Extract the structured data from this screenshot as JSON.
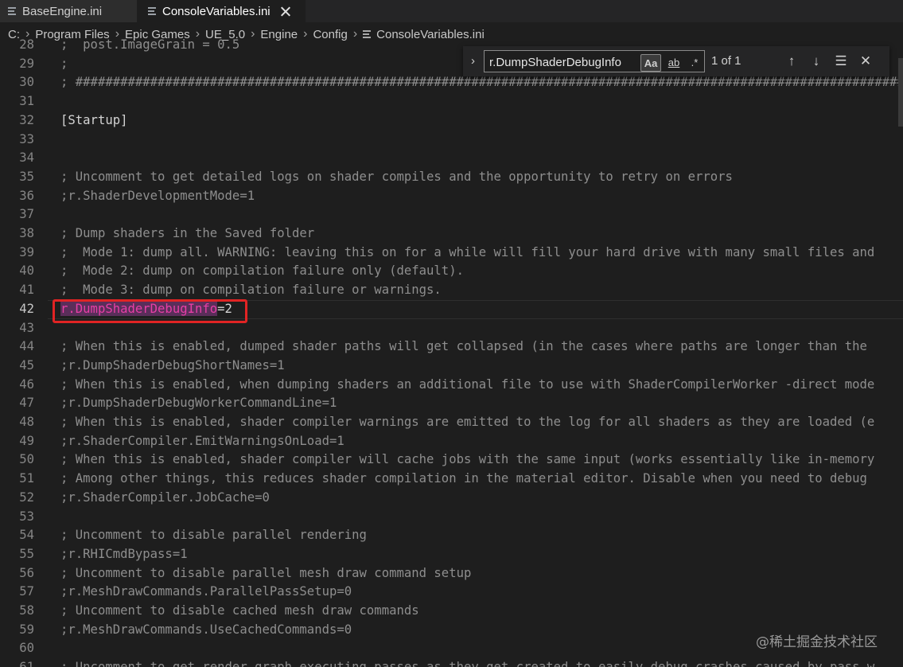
{
  "tabs": [
    {
      "label": "BaseEngine.ini",
      "icon": "file-lines-icon"
    },
    {
      "label": "ConsoleVariables.ini",
      "icon": "file-lines-icon"
    }
  ],
  "breadcrumb": [
    "C:",
    "Program Files",
    "Epic Games",
    "UE_5.0",
    "Engine",
    "Config",
    "ConsoleVariables.ini"
  ],
  "find": {
    "query": "r.DumpShaderDebugInfo",
    "match_case_label": "Aa",
    "whole_word_label": "ab",
    "regex_label": ".*",
    "count": "1 of 1"
  },
  "editor": {
    "active_line": "42",
    "lines": [
      {
        "n": "28",
        "text": ";  post.ImageGrain = 0.5"
      },
      {
        "n": "29",
        "text": ";"
      },
      {
        "n": "30",
        "text": "; ########################################################################################################################"
      },
      {
        "n": "31",
        "text": ""
      },
      {
        "n": "32",
        "text": "[Startup]"
      },
      {
        "n": "33",
        "text": ""
      },
      {
        "n": "34",
        "text": ""
      },
      {
        "n": "35",
        "text": "; Uncomment to get detailed logs on shader compiles and the opportunity to retry on errors"
      },
      {
        "n": "36",
        "text": ";r.ShaderDevelopmentMode=1"
      },
      {
        "n": "37",
        "text": ""
      },
      {
        "n": "38",
        "text": "; Dump shaders in the Saved folder"
      },
      {
        "n": "39",
        "text": ";  Mode 1: dump all. WARNING: leaving this on for a while will fill your hard drive with many small files and"
      },
      {
        "n": "40",
        "text": ";  Mode 2: dump on compilation failure only (default)."
      },
      {
        "n": "41",
        "text": ";  Mode 3: dump on compilation failure or warnings."
      },
      {
        "n": "42",
        "match": "r.DumpShaderDebugInfo",
        "rest": "=2"
      },
      {
        "n": "43",
        "text": ""
      },
      {
        "n": "44",
        "text": "; When this is enabled, dumped shader paths will get collapsed (in the cases where paths are longer than the"
      },
      {
        "n": "45",
        "text": ";r.DumpShaderDebugShortNames=1"
      },
      {
        "n": "46",
        "text": "; When this is enabled, when dumping shaders an additional file to use with ShaderCompilerWorker -direct mode"
      },
      {
        "n": "47",
        "text": ";r.DumpShaderDebugWorkerCommandLine=1"
      },
      {
        "n": "48",
        "text": "; When this is enabled, shader compiler warnings are emitted to the log for all shaders as they are loaded (e"
      },
      {
        "n": "49",
        "text": ";r.ShaderCompiler.EmitWarningsOnLoad=1"
      },
      {
        "n": "50",
        "text": "; When this is enabled, shader compiler will cache jobs with the same input (works essentially like in-memory"
      },
      {
        "n": "51",
        "text": "; Among other things, this reduces shader compilation in the material editor. Disable when you need to debug"
      },
      {
        "n": "52",
        "text": ";r.ShaderCompiler.JobCache=0"
      },
      {
        "n": "53",
        "text": ""
      },
      {
        "n": "54",
        "text": "; Uncomment to disable parallel rendering"
      },
      {
        "n": "55",
        "text": ";r.RHICmdBypass=1"
      },
      {
        "n": "56",
        "text": "; Uncomment to disable parallel mesh draw command setup"
      },
      {
        "n": "57",
        "text": ";r.MeshDrawCommands.ParallelPassSetup=0"
      },
      {
        "n": "58",
        "text": "; Uncomment to disable cached mesh draw commands"
      },
      {
        "n": "59",
        "text": ";r.MeshDrawCommands.UseCachedCommands=0"
      },
      {
        "n": "60",
        "text": ""
      },
      {
        "n": "61",
        "text": "; Uncomment to get render graph executing passes as they get created to easily debug crashes caused by pass w"
      }
    ]
  },
  "watermark": "@稀土掘金技术社区",
  "colors": {
    "match_highlight": "#5a2e5a",
    "match_text": "#e73ea6",
    "annotation_box": "#e12424"
  }
}
